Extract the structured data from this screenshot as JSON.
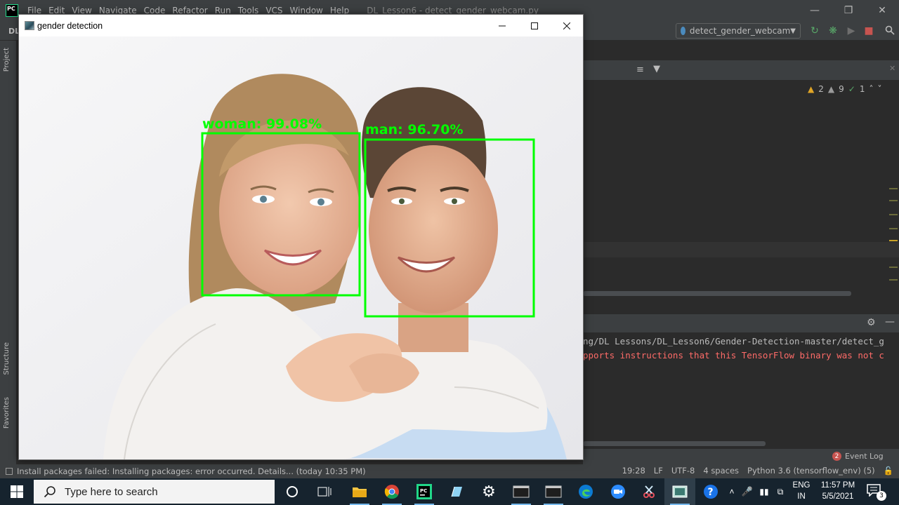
{
  "ide": {
    "menu": [
      "File",
      "Edit",
      "View",
      "Navigate",
      "Code",
      "Refactor",
      "Run",
      "Tools",
      "VCS",
      "Window",
      "Help"
    ],
    "title": "DL_Lesson6 - detect_gender_webcam.py",
    "project_label": "DL",
    "run_config": "detect_gender_webcam",
    "inspections": {
      "warnings": "2",
      "weak_warnings": "9",
      "ok": "1"
    },
    "console": {
      "line1": "ng/DL Lessons/DL_Lesson6/Gender-Detection-master/detect_g",
      "line2": "pports instructions that this TensorFlow binary was not c"
    },
    "event_log": {
      "label": "Event Log",
      "count": "2"
    },
    "sidebar": {
      "project": "Project",
      "structure": "Structure",
      "favorites": "Favorites"
    },
    "status": {
      "message": "Install packages failed: Installing packages: error occurred. Details... (today 10:35 PM)",
      "position": "19:28",
      "line_ending": "LF",
      "encoding": "UTF-8",
      "indent": "4 spaces",
      "interpreter": "Python 3.6 (tensorflow_env) (5)"
    }
  },
  "cv_window": {
    "title": "gender detection",
    "detections": [
      {
        "label": "woman: 99.08%"
      },
      {
        "label": "man: 96.70%"
      }
    ],
    "box_color": "#00ff00"
  },
  "taskbar": {
    "search_placeholder": "Type here to search",
    "lang_top": "ENG",
    "lang_bottom": "IN",
    "time": "11:57 PM",
    "date": "5/5/2021",
    "notification_count": "3"
  },
  "colors": {
    "ide_bg": "#2b2b2b",
    "ide_panel": "#3c3f41",
    "taskbar": "#16232e",
    "error_text": "#ff6b68"
  }
}
